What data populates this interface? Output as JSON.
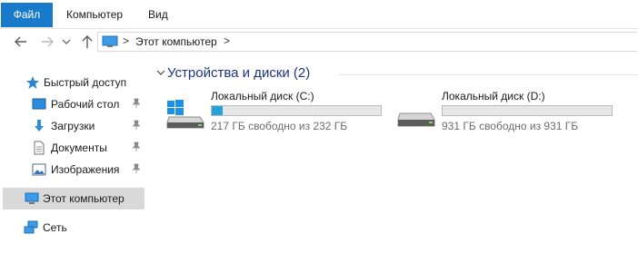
{
  "ribbon": {
    "tabs": [
      {
        "label": "Файл"
      },
      {
        "label": "Компьютер"
      },
      {
        "label": "Вид"
      }
    ]
  },
  "nav": {
    "back_icon": "arrow-left-icon",
    "forward_icon": "arrow-right-icon",
    "recent_icon": "chevron-down-icon",
    "up_icon": "arrow-up-icon",
    "address": {
      "location": "Этот компьютер",
      "separator": ">"
    }
  },
  "sidebar": {
    "items": [
      {
        "label": "Быстрый доступ",
        "icon": "star-icon"
      },
      {
        "label": "Рабочий стол",
        "icon": "desktop-icon",
        "pinned": true
      },
      {
        "label": "Загрузки",
        "icon": "download-icon",
        "pinned": true
      },
      {
        "label": "Документы",
        "icon": "documents-icon",
        "pinned": true
      },
      {
        "label": "Изображения",
        "icon": "pictures-icon",
        "pinned": true
      },
      {
        "label": "Этот компьютер",
        "icon": "computer-icon",
        "selected": true
      },
      {
        "label": "Сеть",
        "icon": "network-icon"
      }
    ]
  },
  "main": {
    "group_title": "Устройства и диски (2)",
    "drives": [
      {
        "name": "Локальный диск (C:)",
        "free_text": "217 ГБ свободно из 232 ГБ",
        "used_fraction": 0.065,
        "icon": "system-drive-icon"
      },
      {
        "name": "Локальный диск (D:)",
        "free_text": "931 ГБ свободно из 931 ГБ",
        "used_fraction": 0.0,
        "icon": "hard-drive-icon"
      }
    ]
  },
  "colors": {
    "accent": "#1979ca",
    "bar_fill": "#26a0da",
    "group_title": "#1e3287",
    "selected_bg": "#d9d9d9"
  }
}
